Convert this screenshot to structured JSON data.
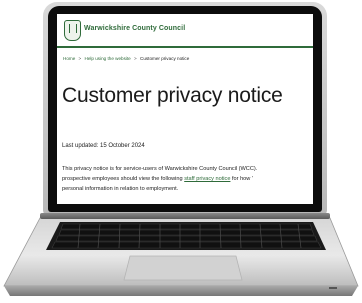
{
  "site": {
    "org_name": "Warwickshire County Council",
    "crest_icon": "council-crest-icon",
    "accent_color": "#2f6b3a"
  },
  "breadcrumb": {
    "items": [
      "Home",
      "Help using the website",
      "Customer privacy notice"
    ],
    "separator": ">"
  },
  "page": {
    "title": "Customer privacy notice",
    "last_updated": "Last updated: 15 October 2024",
    "para_line1": "This privacy notice is for service-users of Warwickshire County Council (WCC).",
    "para_line2_a": "prospective employees should view the following ",
    "para_line2_link": "staff privacy notice",
    "para_line2_b": " for how '",
    "para_line3": "personal information in relation to employment."
  },
  "device": {
    "type": "laptop-icon"
  }
}
